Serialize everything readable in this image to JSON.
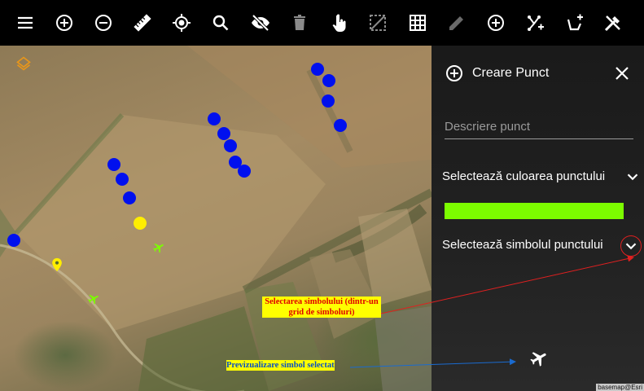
{
  "toolbar": {
    "buttons": [
      {
        "name": "menu-icon"
      },
      {
        "name": "zoom-in-icon"
      },
      {
        "name": "zoom-out-icon"
      },
      {
        "name": "ruler-icon"
      },
      {
        "name": "locate-icon"
      },
      {
        "name": "search-icon"
      },
      {
        "name": "visibility-off-icon"
      },
      {
        "name": "delete-icon"
      },
      {
        "name": "touch-icon"
      },
      {
        "name": "select-area-icon"
      },
      {
        "name": "grid-icon"
      },
      {
        "name": "edit-icon"
      },
      {
        "name": "add-circle-icon"
      },
      {
        "name": "add-line-icon"
      },
      {
        "name": "add-polygon-icon"
      },
      {
        "name": "tools-icon"
      }
    ]
  },
  "panel": {
    "title": "Creare Punct",
    "description_placeholder": "Descriere punct",
    "color_label": "Selectează culoarea punctului",
    "selected_color": "#7cfc00",
    "symbol_label": "Selectează simbolul punctului"
  },
  "annotations": {
    "symbol_grid_note": "Selectarea simbolului (dintr-un grid de simboluri)",
    "preview_note": "Previzualizare simbol selectat"
  },
  "attribution": "basemap@Esri",
  "colors": {
    "blue_point": "#0010ee",
    "yellow_point": "#ffee00",
    "green_symbol": "#7cfc00",
    "layers_icon": "#e8961a"
  }
}
